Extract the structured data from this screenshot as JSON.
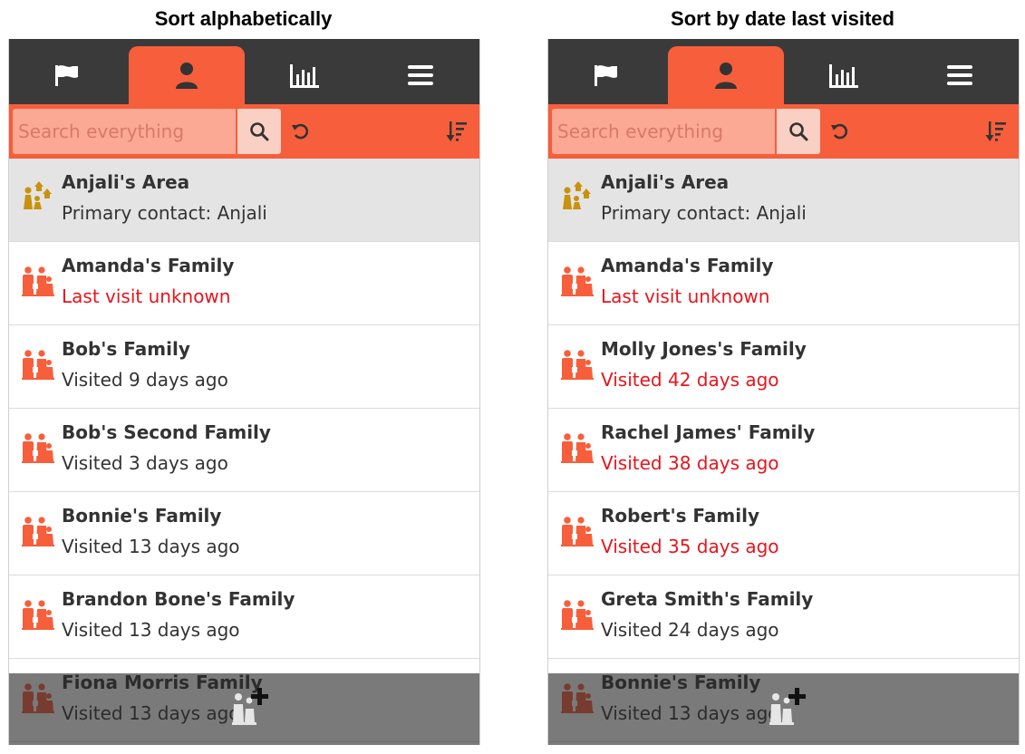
{
  "panels": [
    {
      "heading": "Sort alphabetically",
      "nav": [
        "flag-icon",
        "person-icon",
        "analytics-icon",
        "menu-icon"
      ],
      "search_placeholder": "Search everything",
      "rows": [
        {
          "title": "Anjali's Area",
          "subtitle": "Primary contact: Anjali",
          "icon": "area-icon",
          "overdue": false,
          "selected": true
        },
        {
          "title": "Amanda's Family",
          "subtitle": "Last visit unknown",
          "icon": "family-icon",
          "overdue": true
        },
        {
          "title": "Bob's Family",
          "subtitle": "Visited 9 days ago",
          "icon": "family-icon",
          "overdue": false
        },
        {
          "title": "Bob's Second Family",
          "subtitle": "Visited 3 days ago",
          "icon": "family-icon",
          "overdue": false
        },
        {
          "title": "Bonnie's Family",
          "subtitle": "Visited 13 days ago",
          "icon": "family-icon",
          "overdue": false
        },
        {
          "title": "Brandon Bone's Family",
          "subtitle": "Visited 13 days ago",
          "icon": "family-icon",
          "overdue": false
        },
        {
          "title": "Fiona Morris Family",
          "subtitle": "Visited 13 days ago",
          "icon": "family-icon",
          "overdue": false
        }
      ]
    },
    {
      "heading": "Sort by date last visited",
      "nav": [
        "flag-icon",
        "person-icon",
        "analytics-icon",
        "menu-icon"
      ],
      "search_placeholder": "Search everything",
      "rows": [
        {
          "title": "Anjali's Area",
          "subtitle": "Primary contact: Anjali",
          "icon": "area-icon",
          "overdue": false,
          "selected": true
        },
        {
          "title": "Amanda's Family",
          "subtitle": "Last visit unknown",
          "icon": "family-icon",
          "overdue": true
        },
        {
          "title": "Molly Jones's Family",
          "subtitle": "Visited 42 days ago",
          "icon": "family-icon",
          "overdue": true
        },
        {
          "title": "Rachel James' Family",
          "subtitle": "Visited 38 days ago",
          "icon": "family-icon",
          "overdue": true
        },
        {
          "title": "Robert's Family",
          "subtitle": "Visited 35 days ago",
          "icon": "family-icon",
          "overdue": true
        },
        {
          "title": "Greta Smith's Family",
          "subtitle": "Visited 24 days ago",
          "icon": "family-icon",
          "overdue": false
        },
        {
          "title": "Bonnie's Family",
          "subtitle": "Visited 13 days ago",
          "icon": "family-icon",
          "overdue": false
        }
      ]
    }
  ],
  "colors": {
    "accent": "#f75e3b",
    "navbar": "#3a3a3a",
    "overdue_text": "#e8141c",
    "area_icon": "#c9920e"
  }
}
